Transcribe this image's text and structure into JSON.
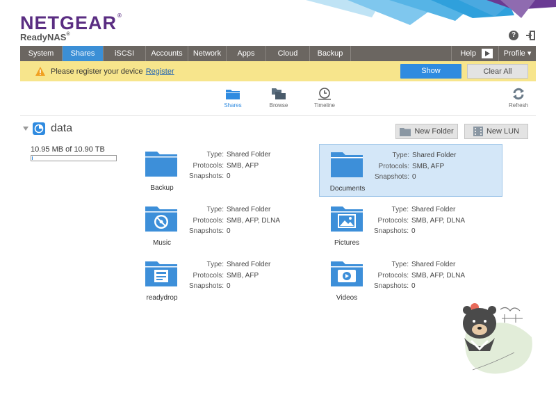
{
  "header": {
    "logo": "NETGEAR",
    "logo_mark": "®",
    "product": "ReadyNAS",
    "product_mark": "®"
  },
  "nav": {
    "items": [
      {
        "label": "System",
        "active": false
      },
      {
        "label": "Shares",
        "active": true
      },
      {
        "label": "iSCSI",
        "active": false
      },
      {
        "label": "Accounts",
        "active": false
      },
      {
        "label": "Network",
        "active": false
      },
      {
        "label": "Apps",
        "active": false
      },
      {
        "label": "Cloud",
        "active": false
      },
      {
        "label": "Backup",
        "active": false
      }
    ],
    "help_label": "Help",
    "profile_label": "Profile ▾"
  },
  "alert": {
    "message": "Please register your device",
    "link": "Register",
    "show_label": "Show",
    "clear_label": "Clear All"
  },
  "views": {
    "shares": "Shares",
    "browse": "Browse",
    "timeline": "Timeline",
    "refresh": "Refresh"
  },
  "volume": {
    "name": "data",
    "capacity": "10.95 MB of 10.90 TB",
    "used_fraction": 0.001,
    "new_folder": "New Folder",
    "new_lun": "New LUN"
  },
  "share_labels": {
    "type": "Type:",
    "protocols": "Protocols:",
    "snapshots": "Snapshots:"
  },
  "shares": [
    {
      "name": "Backup",
      "type": "Shared Folder",
      "protocols": "SMB, AFP",
      "snapshots": "0",
      "icon": "folder-icon"
    },
    {
      "name": "Documents",
      "type": "Shared Folder",
      "protocols": "SMB, AFP",
      "snapshots": "0",
      "icon": "folder-icon"
    },
    {
      "name": "Music",
      "type": "Shared Folder",
      "protocols": "SMB, AFP, DLNA",
      "snapshots": "0",
      "icon": "music-folder-icon"
    },
    {
      "name": "Pictures",
      "type": "Shared Folder",
      "protocols": "SMB, AFP, DLNA",
      "snapshots": "0",
      "icon": "pictures-folder-icon"
    },
    {
      "name": "readydrop",
      "type": "Shared Folder",
      "protocols": "SMB, AFP",
      "snapshots": "0",
      "icon": "readydrop-folder-icon"
    },
    {
      "name": "Videos",
      "type": "Shared Folder",
      "protocols": "SMB, AFP, DLNA",
      "snapshots": "0",
      "icon": "video-folder-icon"
    }
  ],
  "colors": {
    "brand": "#5a2d82",
    "accent": "#2f8be0",
    "nav": "#6b6661",
    "alert": "#f7e58c"
  }
}
